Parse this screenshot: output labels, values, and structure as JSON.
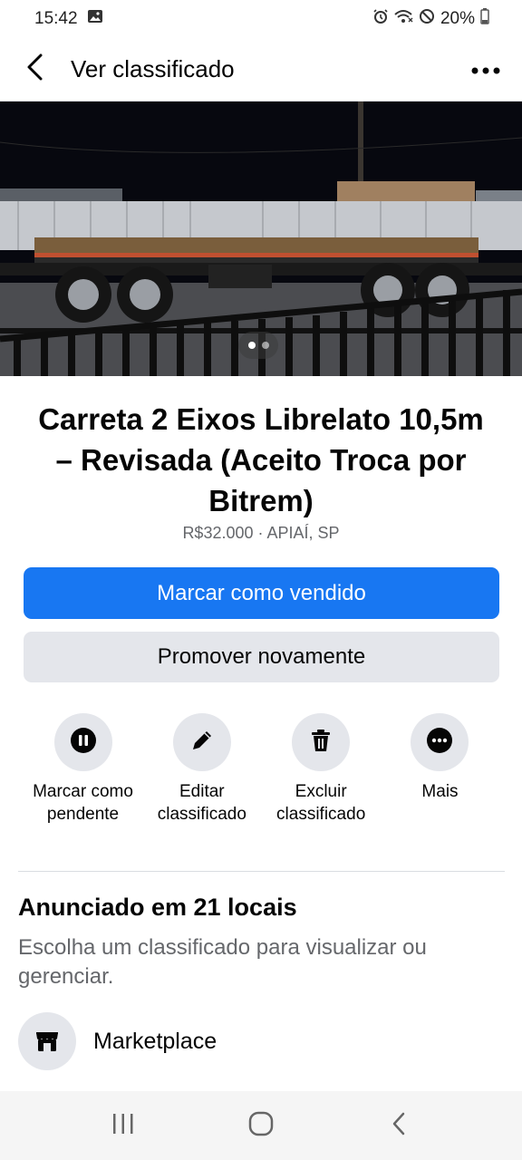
{
  "status_bar": {
    "time": "15:42",
    "battery": "20%",
    "icons": [
      "gallery-icon",
      "alarm-icon",
      "wifi-icon",
      "do-not-disturb-icon",
      "battery-icon"
    ]
  },
  "header": {
    "title": "Ver classificado",
    "back_icon": "back-arrow-icon",
    "more_icon": "more-horizontal-icon"
  },
  "photo": {
    "description_icon": "listing-photo",
    "page_dots": 2,
    "current_page": 1
  },
  "listing": {
    "title": "Carreta 2 Eixos Librelato 10,5m – Revisada (Aceito Troca por Bitrem)",
    "meta": "R$32.000 · APIAÍ, SP"
  },
  "buttons": {
    "mark_sold": "Marcar como vendido",
    "promote": "Promover novamente"
  },
  "actions": [
    {
      "label": "Marcar como pendente",
      "icon": "pause-icon"
    },
    {
      "label": "Editar classificado",
      "icon": "pencil-icon"
    },
    {
      "label": "Excluir classificado",
      "icon": "trash-icon"
    },
    {
      "label": "Mais",
      "icon": "more-horizontal-icon"
    }
  ],
  "locations": {
    "title": "Anunciado em 21 locais",
    "description": "Escolha um classificado para visualizar ou gerenciar.",
    "items": [
      {
        "label": "Marketplace",
        "icon": "marketplace-store-icon"
      }
    ]
  },
  "nav_bar": {
    "buttons": [
      "recent-apps-icon",
      "home-icon",
      "back-icon"
    ]
  },
  "colors": {
    "primary": "#1877f2",
    "secondary_bg": "#e4e6eb",
    "muted_text": "#65676b"
  }
}
